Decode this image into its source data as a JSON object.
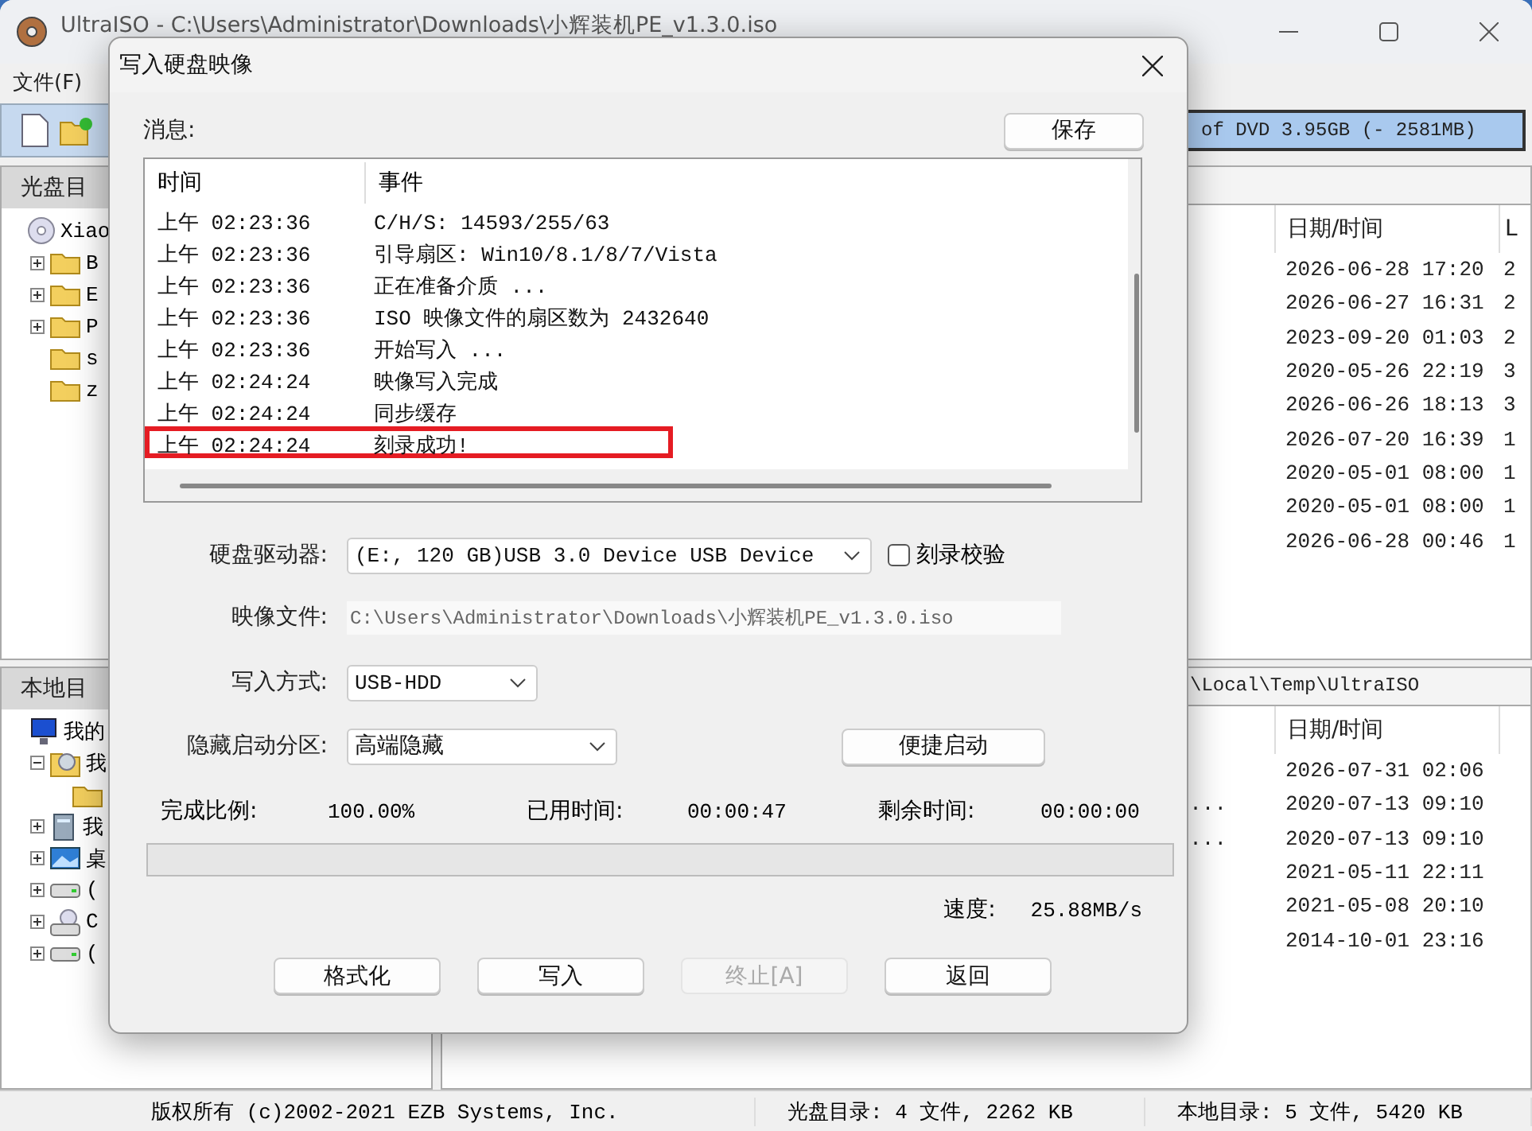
{
  "window": {
    "title": "UltraISO - C:\\Users\\Administrator\\Downloads\\小辉装机PE_v1.3.0.iso"
  },
  "menu": [
    "文件(F)"
  ],
  "capacity": {
    "text": "of DVD 3.95GB (- 2581MB)"
  },
  "disc_pane": {
    "header": "光盘目",
    "tree": [
      {
        "label": "Xiao",
        "kind": "disc",
        "children": [
          {
            "label": "B",
            "kind": "folder",
            "expanded": false
          },
          {
            "label": "E",
            "kind": "folder",
            "expanded": false
          },
          {
            "label": "P",
            "kind": "folder",
            "expanded": false
          },
          {
            "label": "s",
            "kind": "folder"
          },
          {
            "label": "z",
            "kind": "folder"
          }
        ]
      }
    ]
  },
  "local_pane": {
    "header": "本地目",
    "tree": [
      {
        "label": "我的",
        "kind": "computer",
        "children": [
          {
            "label": "我",
            "kind": "documents",
            "expanded": true,
            "children": [
              {
                "kind": "folder"
              }
            ]
          },
          {
            "label": "我",
            "kind": "cabinet",
            "expanded": false
          },
          {
            "label": "桌",
            "kind": "desktop",
            "expanded": false
          },
          {
            "label": "(",
            "kind": "drive",
            "expanded": false
          },
          {
            "label": "C",
            "kind": "cdrom",
            "expanded": false
          },
          {
            "label": "(",
            "kind": "drive",
            "expanded": false
          }
        ]
      }
    ]
  },
  "disc_list": {
    "columns": [
      "日期/时间",
      "L"
    ],
    "rows": [
      {
        "date_time": "2026-06-28 17:20",
        "column_2": "2"
      },
      {
        "date_time": "2026-06-27 16:31",
        "column_2": "2"
      },
      {
        "date_time": "2023-09-20 01:03",
        "column_2": "2"
      },
      {
        "date_time": "2020-05-26 22:19",
        "column_2": "3"
      },
      {
        "date_time": "2026-06-26 18:13",
        "column_2": "3"
      },
      {
        "date_time": "2026-07-20 16:39",
        "column_2": "1"
      },
      {
        "date_time": "2020-05-01 08:00",
        "column_2": "1"
      },
      {
        "date_time": "2020-05-01 08:00",
        "column_2": "1"
      },
      {
        "date_time": "2026-06-28 00:46",
        "column_2": "1"
      }
    ]
  },
  "local_path": "\\Local\\Temp\\UltraISO",
  "local_list": {
    "columns": [
      "日期/时间"
    ],
    "rows": [
      {
        "date_time": "2026-07-31 02:06"
      },
      {
        "column_1": "...",
        "date_time": "2020-07-13 09:10"
      },
      {
        "column_1": "...",
        "date_time": "2020-07-13 09:10"
      },
      {
        "date_time": "2021-05-11 22:11"
      },
      {
        "date_time": "2021-05-08 20:10"
      },
      {
        "date_time": "2014-10-01 23:16"
      }
    ]
  },
  "status_bar": [
    "版权所有 (c)2002-2021 EZB Systems, Inc.",
    "光盘目录: 4 文件, 2262 KB",
    "本地目录: 5 文件, 5420 KB"
  ],
  "dialog": {
    "title": "写入硬盘映像",
    "messages_label": "消息:",
    "save_button": "保存",
    "log": {
      "columns": [
        "时间",
        "事件"
      ],
      "rows": [
        {
          "time": "上午 02:23:36",
          "event": "C/H/S: 14593/255/63",
          "highlighted": false
        },
        {
          "time": "上午 02:23:36",
          "event": "引导扇区: Win10/8.1/8/7/Vista",
          "highlighted": false
        },
        {
          "time": "上午 02:23:36",
          "event": "正在准备介质 ...",
          "highlighted": false
        },
        {
          "time": "上午 02:23:36",
          "event": "ISO 映像文件的扇区数为 2432640",
          "highlighted": false
        },
        {
          "time": "上午 02:23:36",
          "event": "开始写入 ...",
          "highlighted": false
        },
        {
          "time": "上午 02:24:24",
          "event": "映像写入完成",
          "highlighted": false
        },
        {
          "time": "上午 02:24:24",
          "event": "同步缓存",
          "highlighted": false
        },
        {
          "time": "上午 02:24:24",
          "event": "刻录成功!",
          "highlighted": true
        }
      ]
    },
    "drive": {
      "label": "硬盘驱动器:",
      "value": "(E:, 120 GB)USB 3.0 Device USB Device"
    },
    "verify": {
      "label": "刻录校验",
      "checked": false
    },
    "image_file": {
      "label": "映像文件:",
      "value": "C:\\Users\\Administrator\\Downloads\\小辉装机PE_v1.3.0.iso"
    },
    "write_method": {
      "label": "写入方式:",
      "value": "USB-HDD"
    },
    "hide_partition": {
      "label": "隐藏启动分区:",
      "value": "高端隐藏"
    },
    "quick_boot_button": "便捷启动",
    "stats": [
      {
        "label": "完成比例:",
        "value": "100.00%"
      },
      {
        "label": "已用时间:",
        "value": "00:00:47"
      },
      {
        "label": "剩余时间:",
        "value": "00:00:00"
      }
    ],
    "progress": {
      "level": 0
    },
    "speed": {
      "label": "速度:",
      "value": "25.88MB/s"
    },
    "buttons": [
      {
        "label": "格式化",
        "disabled": false
      },
      {
        "label": "写入",
        "disabled": false
      },
      {
        "label": "终止[A]",
        "disabled": true
      },
      {
        "label": "返回",
        "disabled": false
      }
    ]
  }
}
